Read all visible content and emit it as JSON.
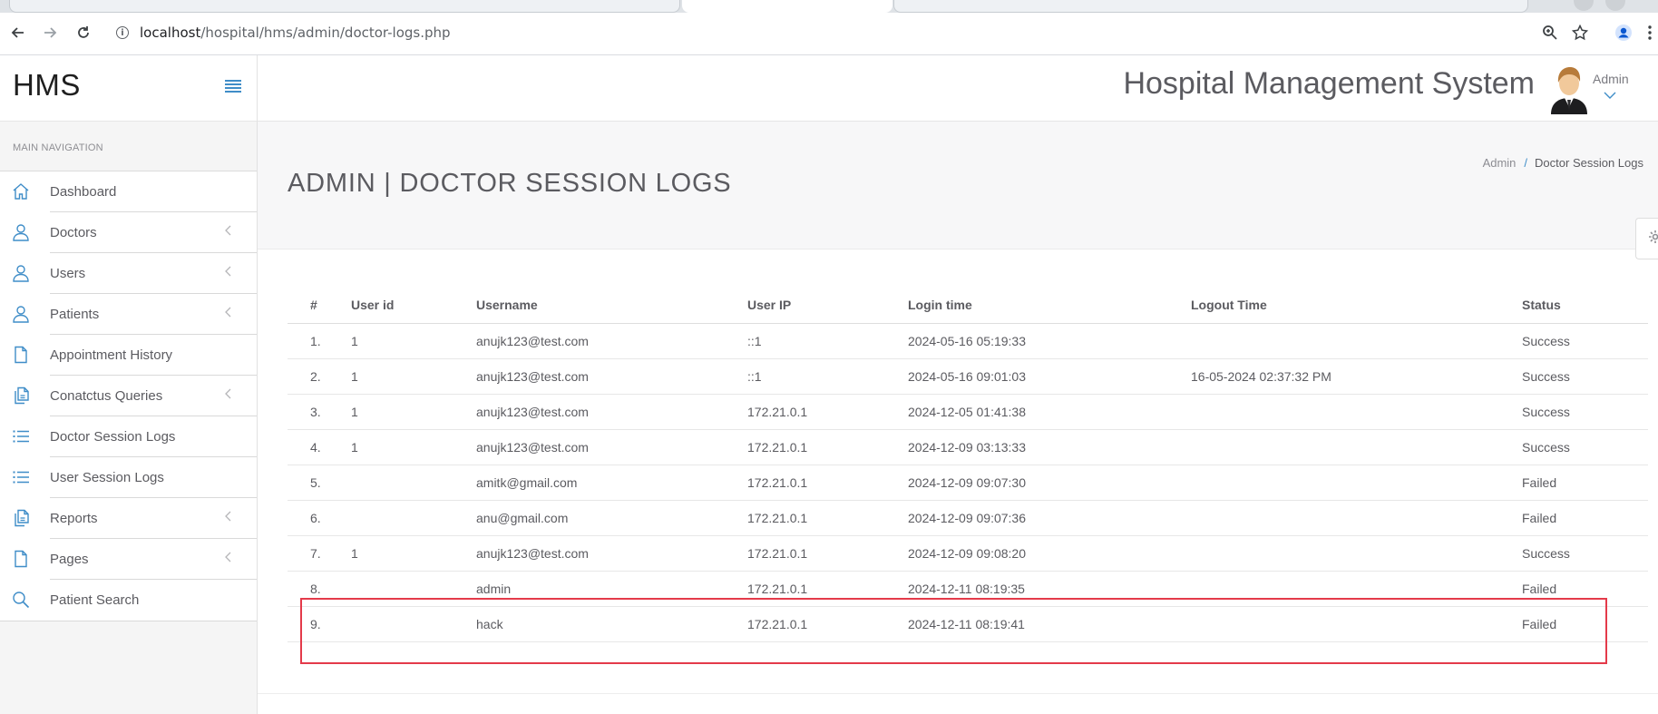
{
  "browser": {
    "url_host": "localhost",
    "url_path": "/hospital/hms/admin/doctor-logs.php"
  },
  "app": {
    "brand": "HMS",
    "system_title": "Hospital Management System",
    "user_name": "Admin"
  },
  "sidebar": {
    "heading": "MAIN NAVIGATION",
    "items": [
      {
        "label": "Dashboard",
        "icon": "home-icon",
        "has_submenu": false
      },
      {
        "label": "Doctors",
        "icon": "user-icon",
        "has_submenu": true
      },
      {
        "label": "Users",
        "icon": "user-icon",
        "has_submenu": true
      },
      {
        "label": "Patients",
        "icon": "user-icon",
        "has_submenu": true
      },
      {
        "label": "Appointment History",
        "icon": "file-icon",
        "has_submenu": false
      },
      {
        "label": "Conatctus Queries",
        "icon": "files-icon",
        "has_submenu": true
      },
      {
        "label": "Doctor Session Logs",
        "icon": "list-icon",
        "has_submenu": false
      },
      {
        "label": "User Session Logs",
        "icon": "list-icon",
        "has_submenu": false
      },
      {
        "label": "Reports",
        "icon": "files-icon",
        "has_submenu": true
      },
      {
        "label": "Pages",
        "icon": "file-icon",
        "has_submenu": true
      },
      {
        "label": "Patient Search",
        "icon": "search-icon",
        "has_submenu": false
      }
    ]
  },
  "page": {
    "title": "ADMIN | DOCTOR SESSION LOGS",
    "breadcrumb": [
      "Admin",
      "Doctor Session Logs"
    ]
  },
  "table": {
    "columns": [
      "#",
      "User id",
      "Username",
      "User IP",
      "Login time",
      "Logout Time",
      "Status"
    ],
    "rows": [
      [
        "1.",
        "1",
        "anujk123@test.com",
        "::1",
        "2024-05-16 05:19:33",
        "",
        "Success"
      ],
      [
        "2.",
        "1",
        "anujk123@test.com",
        "::1",
        "2024-05-16 09:01:03",
        "16-05-2024 02:37:32 PM",
        "Success"
      ],
      [
        "3.",
        "1",
        "anujk123@test.com",
        "172.21.0.1",
        "2024-12-05 01:41:38",
        "",
        "Success"
      ],
      [
        "4.",
        "1",
        "anujk123@test.com",
        "172.21.0.1",
        "2024-12-09 03:13:33",
        "",
        "Success"
      ],
      [
        "5.",
        "",
        "amitk@gmail.com",
        "172.21.0.1",
        "2024-12-09 09:07:30",
        "",
        "Failed"
      ],
      [
        "6.",
        "",
        "anu@gmail.com",
        "172.21.0.1",
        "2024-12-09 09:07:36",
        "",
        "Failed"
      ],
      [
        "7.",
        "1",
        "anujk123@test.com",
        "172.21.0.1",
        "2024-12-09 09:08:20",
        "",
        "Success"
      ],
      [
        "8.",
        "",
        "admin",
        "172.21.0.1",
        "2024-12-11 08:19:35",
        "",
        "Failed"
      ],
      [
        "9.",
        "",
        "hack",
        "172.21.0.1",
        "2024-12-11 08:19:41",
        "",
        "Failed"
      ]
    ]
  },
  "highlight": {
    "row_number": "9.",
    "color": "#e43a4a"
  },
  "colors": {
    "accent": "#3f8dc8",
    "text": "#5b5b60"
  }
}
